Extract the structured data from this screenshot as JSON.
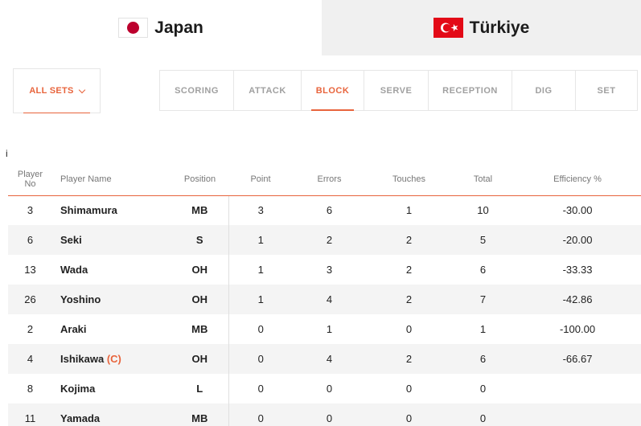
{
  "teams": {
    "home": {
      "name": "Japan",
      "flag_icon": "japan-flag-icon"
    },
    "away": {
      "name": "Türkiye",
      "flag_icon": "turkey-flag-icon"
    }
  },
  "sets_filter": {
    "label": "ALL SETS"
  },
  "tabs": [
    {
      "label": "SCORING",
      "active": false
    },
    {
      "label": "ATTACK",
      "active": false
    },
    {
      "label": "BLOCK",
      "active": true
    },
    {
      "label": "SERVE",
      "active": false
    },
    {
      "label": "RECEPTION",
      "active": false
    },
    {
      "label": "DIG",
      "active": false
    },
    {
      "label": "SET",
      "active": false
    }
  ],
  "info_marker": "i",
  "table": {
    "headers": {
      "player_no_line1": "Player",
      "player_no_line2": "No",
      "player_name": "Player Name",
      "position": "Position",
      "point": "Point",
      "errors": "Errors",
      "touches": "Touches",
      "total": "Total",
      "efficiency": "Efficiency %"
    },
    "rows": [
      {
        "no": "3",
        "name": "Shimamura",
        "captain": "",
        "position": "MB",
        "point": "3",
        "errors": "6",
        "touches": "1",
        "total": "10",
        "efficiency": "-30.00"
      },
      {
        "no": "6",
        "name": "Seki",
        "captain": "",
        "position": "S",
        "point": "1",
        "errors": "2",
        "touches": "2",
        "total": "5",
        "efficiency": "-20.00"
      },
      {
        "no": "13",
        "name": "Wada",
        "captain": "",
        "position": "OH",
        "point": "1",
        "errors": "3",
        "touches": "2",
        "total": "6",
        "efficiency": "-33.33"
      },
      {
        "no": "26",
        "name": "Yoshino",
        "captain": "",
        "position": "OH",
        "point": "1",
        "errors": "4",
        "touches": "2",
        "total": "7",
        "efficiency": "-42.86"
      },
      {
        "no": "2",
        "name": "Araki",
        "captain": "",
        "position": "MB",
        "point": "0",
        "errors": "1",
        "touches": "0",
        "total": "1",
        "efficiency": "-100.00"
      },
      {
        "no": "4",
        "name": "Ishikawa",
        "captain": "(C)",
        "position": "OH",
        "point": "0",
        "errors": "4",
        "touches": "2",
        "total": "6",
        "efficiency": "-66.67"
      },
      {
        "no": "8",
        "name": "Kojima",
        "captain": "",
        "position": "L",
        "point": "0",
        "errors": "0",
        "touches": "0",
        "total": "0",
        "efficiency": ""
      },
      {
        "no": "11",
        "name": "Yamada",
        "captain": "",
        "position": "MB",
        "point": "0",
        "errors": "0",
        "touches": "0",
        "total": "0",
        "efficiency": ""
      }
    ]
  },
  "colors": {
    "accent": "#e8643c",
    "japan_red": "#bc002d",
    "turkey_red": "#e30a17"
  }
}
